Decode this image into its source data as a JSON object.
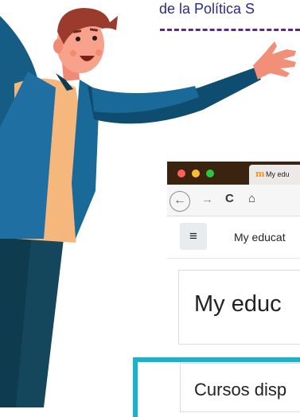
{
  "slide": {
    "headline": "de la Política S"
  },
  "browser": {
    "tab_title": "My edu",
    "tab_icon_glyph": "m",
    "back_glyph": "←",
    "forward_glyph": "→",
    "reload_glyph": "C",
    "home_glyph": "⌂",
    "menu_glyph": "≡",
    "navbar_title": "My educat",
    "page_heading": "My educ",
    "section_title": "Cursos disp"
  },
  "colors": {
    "accent": "#16b4d3",
    "dash": "#5b2a84",
    "headline": "#2b2a8c",
    "titlebar": "#3a2410"
  },
  "icons": [
    "traffic-lights",
    "moodle-icon",
    "back-icon",
    "forward-icon",
    "reload-icon",
    "home-icon",
    "hamburger-icon"
  ]
}
